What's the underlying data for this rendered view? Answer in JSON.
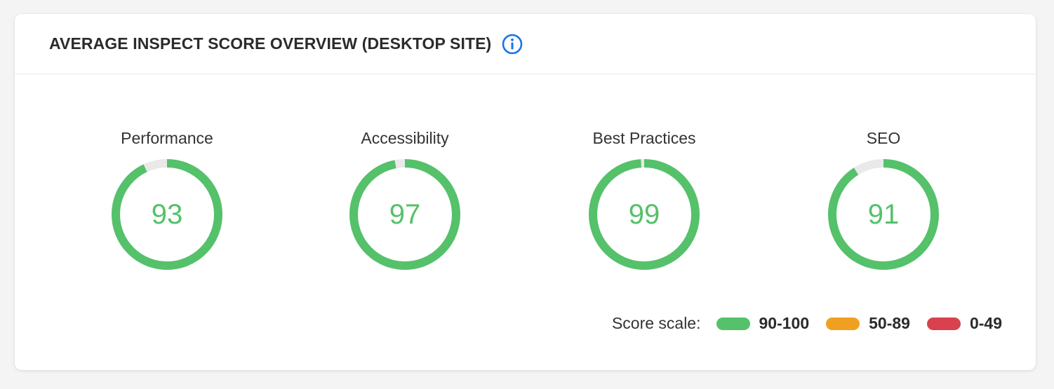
{
  "header": {
    "title": "AVERAGE INSPECT SCORE OVERVIEW (DESKTOP SITE)",
    "info_icon": "info-circle-icon",
    "info_color": "#1a73e8"
  },
  "scores": [
    {
      "label": "Performance",
      "value": 93
    },
    {
      "label": "Accessibility",
      "value": 97
    },
    {
      "label": "Best Practices",
      "value": 99
    },
    {
      "label": "SEO",
      "value": 91
    }
  ],
  "colors": {
    "good": "#55c16a",
    "track": "#e9e9e9"
  },
  "legend": {
    "title": "Score scale:",
    "items": [
      {
        "range": "90-100",
        "color": "#55c16a"
      },
      {
        "range": "50-89",
        "color": "#f0a020"
      },
      {
        "range": "0-49",
        "color": "#d9414f"
      }
    ]
  }
}
